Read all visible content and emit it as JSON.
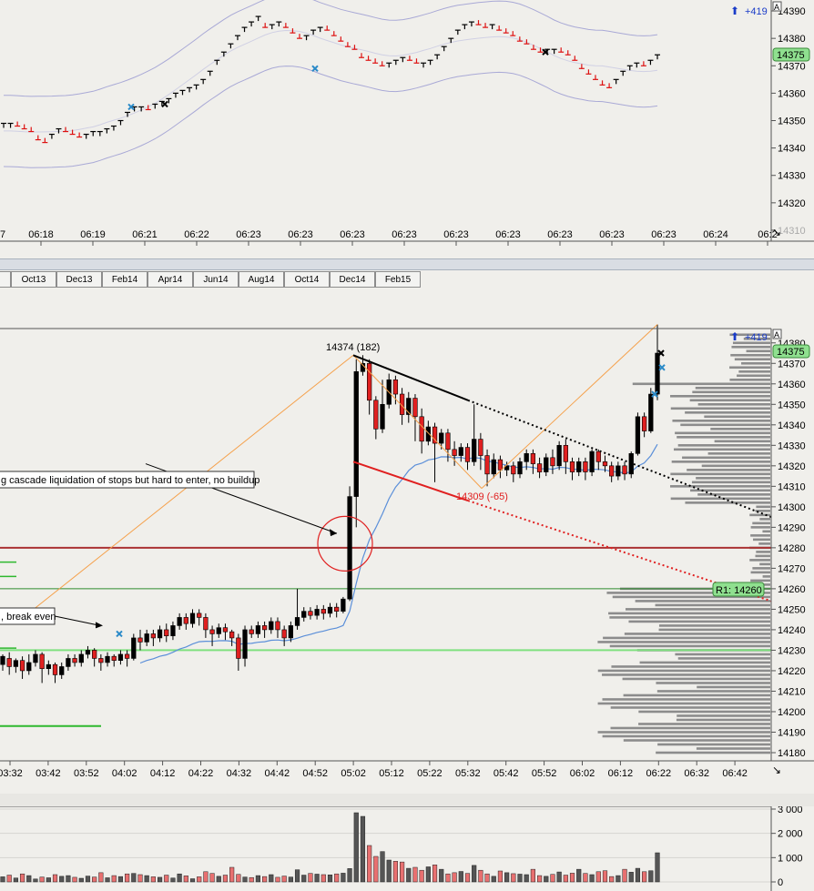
{
  "top_chart": {
    "type": "line",
    "y_ticks": [
      "14390",
      "14380",
      "14370",
      "14360",
      "14350",
      "14340",
      "14330",
      "14320",
      "14310"
    ],
    "ylim": [
      14306,
      14394
    ],
    "x_labels": [
      "06:18",
      "06:19",
      "06:21",
      "06:22",
      "06:23",
      "06:23",
      "06:23",
      "06:23",
      "06:23",
      "06:23",
      "06:23",
      "06:23",
      "06:23",
      "06:24",
      "06:2"
    ],
    "x_label_left": "7",
    "last_price": "14375",
    "pnl": "+419",
    "corner_marker": "A",
    "ticks": [
      14349,
      14349,
      14348,
      14347,
      14346,
      14343,
      14342,
      14345,
      14347,
      14346,
      14345,
      14344,
      14345,
      14346,
      14346,
      14347,
      14348,
      14350,
      14353,
      14355,
      14355,
      14354,
      14356,
      14357,
      14358,
      14360,
      14361,
      14362,
      14363,
      14365,
      14368,
      14372,
      14375,
      14378,
      14381,
      14384,
      14386,
      14388,
      14384,
      14385,
      14386,
      14384,
      14382,
      14380,
      14381,
      14383,
      14384,
      14383,
      14381,
      14379,
      14377,
      14376,
      14373,
      14372,
      14371,
      14370,
      14371,
      14372,
      14373,
      14372,
      14371,
      14371,
      14372,
      14374,
      14377,
      14380,
      14383,
      14385,
      14386,
      14385,
      14384,
      14385,
      14383,
      14382,
      14381,
      14379,
      14378,
      14376,
      14375,
      14376,
      14376,
      14375,
      14374,
      14372,
      14369,
      14367,
      14365,
      14363,
      14362,
      14365,
      14368,
      14370,
      14371,
      14370,
      14372,
      14374
    ]
  },
  "tabs": [
    "Oct13",
    "Dec13",
    "Feb14",
    "Apr14",
    "Jun14",
    "Aug14",
    "Oct14",
    "Dec14",
    "Feb15"
  ],
  "main_chart": {
    "type": "bar",
    "y_ticks": [
      "14380",
      "14370",
      "14360",
      "14350",
      "14340",
      "14330",
      "14320",
      "14310",
      "14300",
      "14290",
      "14280",
      "14270",
      "14260",
      "14250",
      "14240",
      "14230",
      "14220",
      "14210",
      "14200",
      "14190",
      "14180"
    ],
    "ylim": [
      14176,
      14387
    ],
    "x_labels": [
      "03:32",
      "03:42",
      "03:52",
      "04:02",
      "04:12",
      "04:22",
      "04:32",
      "04:42",
      "04:52",
      "05:02",
      "05:12",
      "05:22",
      "05:32",
      "05:42",
      "05:52",
      "06:02",
      "06:12",
      "06:22",
      "06:32",
      "06:42"
    ],
    "last_price": "14375",
    "pnl": "+419",
    "corner_marker": "A",
    "pivot_label": "R1: 14260",
    "pivot_value": 14260,
    "horizontal_line_red": 14280,
    "horizontal_line_green": 14230,
    "high_label": "14374 (182)",
    "low_label": "14309 (-65)",
    "annotation_1": "g cascade liquidation of stops but hard to enter, no buildup",
    "annotation_2": ", break even",
    "candles": [
      [
        14223,
        14227,
        14220,
        14228
      ],
      [
        14226,
        14222,
        14218,
        14229
      ],
      [
        14222,
        14225,
        14219,
        14226
      ],
      [
        14225,
        14220,
        14216,
        14227
      ],
      [
        14220,
        14224,
        14218,
        14228
      ],
      [
        14224,
        14228,
        14222,
        14230
      ],
      [
        14228,
        14221,
        14214,
        14229
      ],
      [
        14221,
        14223,
        14218,
        14225
      ],
      [
        14223,
        14218,
        14214,
        14224
      ],
      [
        14218,
        14222,
        14216,
        14224
      ],
      [
        14222,
        14226,
        14220,
        14228
      ],
      [
        14226,
        14224,
        14222,
        14228
      ],
      [
        14224,
        14228,
        14222,
        14230
      ],
      [
        14228,
        14230,
        14226,
        14232
      ],
      [
        14230,
        14226,
        14222,
        14231
      ],
      [
        14226,
        14224,
        14220,
        14228
      ],
      [
        14224,
        14227,
        14222,
        14229
      ],
      [
        14227,
        14225,
        14222,
        14228
      ],
      [
        14225,
        14228,
        14223,
        14230
      ],
      [
        14228,
        14226,
        14222,
        14230
      ],
      [
        14226,
        14236,
        14225,
        14238
      ],
      [
        14236,
        14234,
        14230,
        14240
      ],
      [
        14234,
        14238,
        14232,
        14240
      ],
      [
        14238,
        14236,
        14232,
        14240
      ],
      [
        14236,
        14240,
        14234,
        14242
      ],
      [
        14240,
        14237,
        14234,
        14243
      ],
      [
        14237,
        14242,
        14235,
        14244
      ],
      [
        14242,
        14246,
        14240,
        14248
      ],
      [
        14246,
        14243,
        14240,
        14248
      ],
      [
        14243,
        14248,
        14241,
        14250
      ],
      [
        14248,
        14246,
        14242,
        14250
      ],
      [
        14246,
        14240,
        14236,
        14248
      ],
      [
        14240,
        14238,
        14232,
        14242
      ],
      [
        14238,
        14241,
        14236,
        14243
      ],
      [
        14241,
        14239,
        14235,
        14243
      ],
      [
        14239,
        14236,
        14232,
        14240
      ],
      [
        14236,
        14226,
        14220,
        14238
      ],
      [
        14226,
        14240,
        14222,
        14242
      ],
      [
        14240,
        14238,
        14236,
        14242
      ],
      [
        14238,
        14242,
        14236,
        14244
      ],
      [
        14242,
        14240,
        14236,
        14244
      ],
      [
        14240,
        14244,
        14238,
        14246
      ],
      [
        14244,
        14240,
        14236,
        14246
      ],
      [
        14240,
        14236,
        14232,
        14242
      ],
      [
        14236,
        14242,
        14234,
        14244
      ],
      [
        14242,
        14246,
        14240,
        14260
      ],
      [
        14246,
        14249,
        14244,
        14251
      ],
      [
        14249,
        14247,
        14245,
        14251
      ],
      [
        14247,
        14250,
        14245,
        14252
      ],
      [
        14250,
        14248,
        14245,
        14252
      ],
      [
        14248,
        14251,
        14246,
        14253
      ],
      [
        14251,
        14249,
        14246,
        14253
      ],
      [
        14249,
        14255,
        14248,
        14256
      ],
      [
        14255,
        14305,
        14254,
        14310
      ],
      [
        14305,
        14366,
        14290,
        14372
      ],
      [
        14366,
        14370,
        14364,
        14374
      ],
      [
        14370,
        14352,
        14345,
        14372
      ],
      [
        14352,
        14338,
        14333,
        14354
      ],
      [
        14338,
        14350,
        14336,
        14362
      ],
      [
        14350,
        14362,
        14348,
        14365
      ],
      [
        14362,
        14355,
        14350,
        14364
      ],
      [
        14355,
        14345,
        14340,
        14358
      ],
      [
        14345,
        14353,
        14341,
        14356
      ],
      [
        14353,
        14344,
        14332,
        14355
      ],
      [
        14344,
        14332,
        14326,
        14348
      ],
      [
        14332,
        14339,
        14330,
        14342
      ],
      [
        14339,
        14331,
        14312,
        14341
      ],
      [
        14331,
        14336,
        14328,
        14338
      ],
      [
        14336,
        14328,
        14322,
        14338
      ],
      [
        14328,
        14325,
        14320,
        14332
      ],
      [
        14325,
        14329,
        14322,
        14331
      ],
      [
        14329,
        14322,
        14318,
        14331
      ],
      [
        14322,
        14333,
        14320,
        14350
      ],
      [
        14333,
        14325,
        14318,
        14336
      ],
      [
        14325,
        14316,
        14310,
        14328
      ],
      [
        14316,
        14323,
        14314,
        14326
      ],
      [
        14323,
        14318,
        14314,
        14325
      ],
      [
        14318,
        14320,
        14315,
        14322
      ],
      [
        14320,
        14316,
        14312,
        14322
      ],
      [
        14316,
        14322,
        14314,
        14324
      ],
      [
        14322,
        14326,
        14318,
        14328
      ],
      [
        14326,
        14321,
        14316,
        14328
      ],
      [
        14321,
        14317,
        14314,
        14324
      ],
      [
        14317,
        14324,
        14315,
        14326
      ],
      [
        14324,
        14320,
        14316,
        14328
      ],
      [
        14320,
        14330,
        14318,
        14332
      ],
      [
        14330,
        14322,
        14316,
        14333
      ],
      [
        14322,
        14317,
        14313,
        14324
      ],
      [
        14317,
        14322,
        14315,
        14324
      ],
      [
        14322,
        14317,
        14313,
        14324
      ],
      [
        14317,
        14327,
        14315,
        14328
      ],
      [
        14327,
        14322,
        14318,
        14328
      ],
      [
        14322,
        14320,
        14317,
        14325
      ],
      [
        14320,
        14315,
        14312,
        14322
      ],
      [
        14315,
        14320,
        14313,
        14322
      ],
      [
        14320,
        14316,
        14313,
        14322
      ],
      [
        14316,
        14326,
        14314,
        14327
      ],
      [
        14326,
        14344,
        14325,
        14346
      ],
      [
        14344,
        14337,
        14334,
        14346
      ],
      [
        14337,
        14355,
        14336,
        14358
      ],
      [
        14355,
        14375,
        14352,
        14389
      ]
    ],
    "volume_ticks": [
      "3 000",
      "2 000",
      "1 000",
      "0"
    ],
    "volume": [
      210,
      280,
      160,
      330,
      260,
      120,
      200,
      170,
      300,
      230,
      260,
      190,
      150,
      240,
      200,
      380,
      170,
      260,
      220,
      330,
      350,
      300,
      260,
      210,
      190,
      280,
      160,
      330,
      250,
      130,
      210,
      420,
      350,
      230,
      280,
      600,
      310,
      200,
      180,
      260,
      220,
      300,
      190,
      240,
      200,
      500,
      280,
      350,
      320,
      300,
      290,
      330,
      360,
      550,
      2850,
      2700,
      1500,
      1050,
      1250,
      900,
      850,
      820,
      560,
      600,
      480,
      620,
      700,
      520,
      330,
      380,
      430,
      350,
      680,
      480,
      330,
      230,
      450,
      380,
      340,
      320,
      300,
      520,
      260,
      230,
      310,
      410,
      280,
      360,
      520,
      350,
      300,
      420,
      460,
      220,
      260,
      520,
      400,
      560,
      420,
      460,
      1200
    ]
  }
}
